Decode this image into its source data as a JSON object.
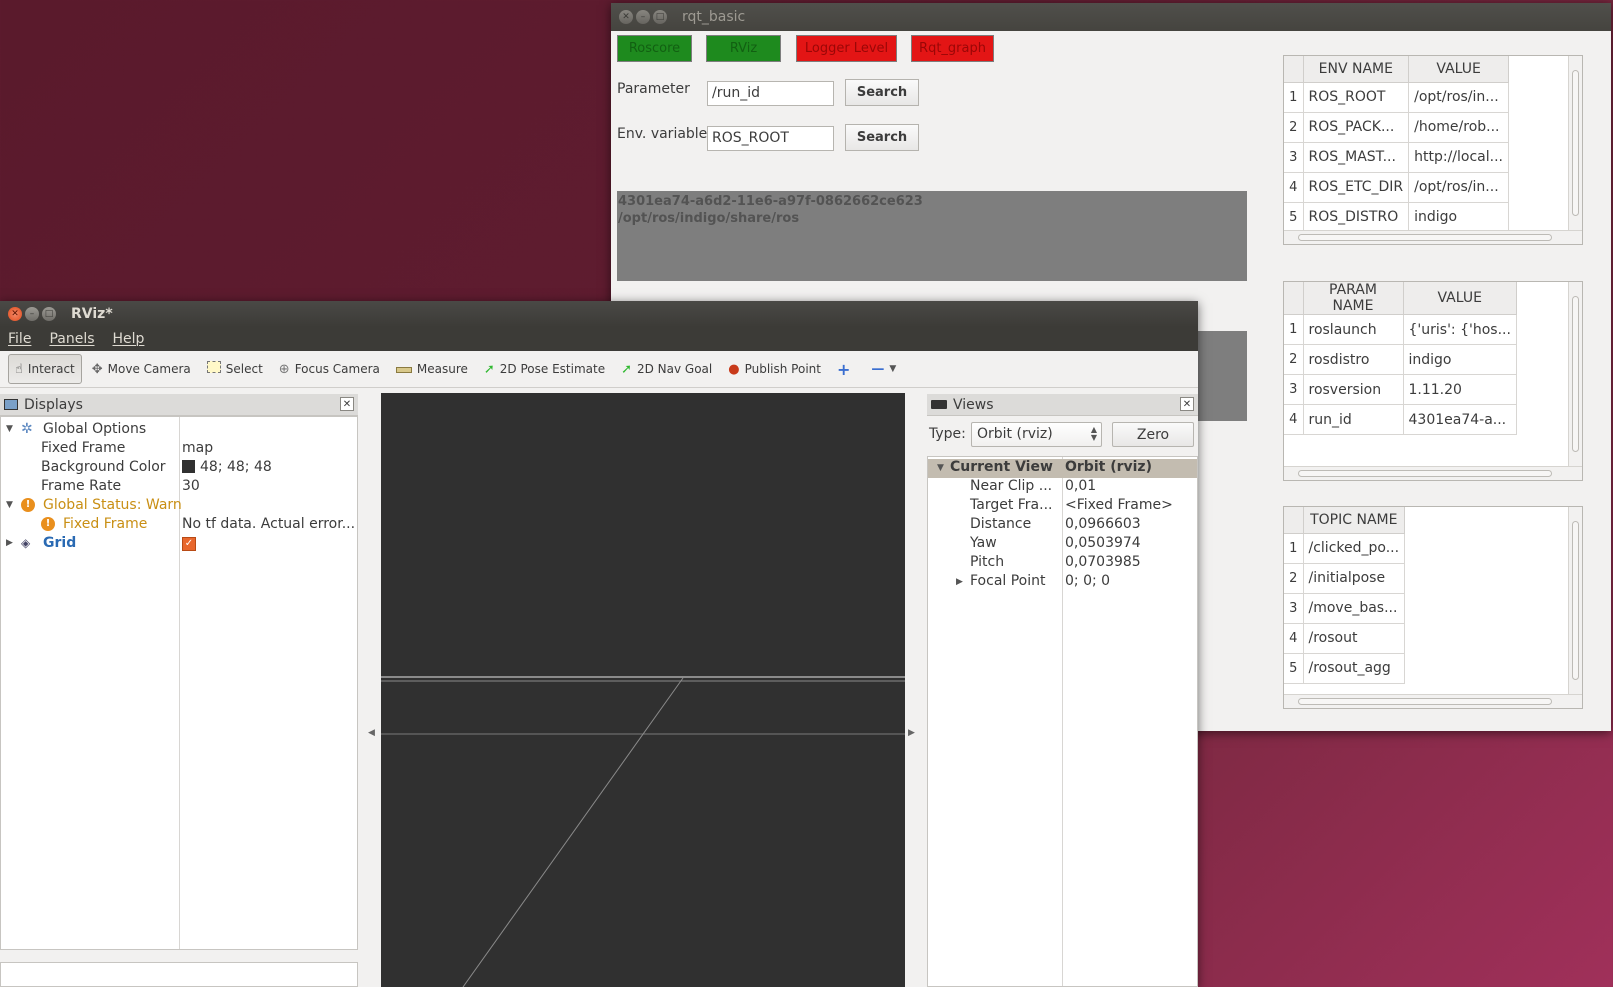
{
  "rqt": {
    "title": "rqt_basic",
    "buttons": [
      {
        "label": "Roscore",
        "color": "#1e8a1e"
      },
      {
        "label": "RViz",
        "color": "#1e8a1e"
      },
      {
        "label": "Logger Level",
        "color": "#e31515"
      },
      {
        "label": "Rqt_graph",
        "color": "#e31515"
      }
    ],
    "param_label": "Parameter",
    "param_value": "/run_id",
    "env_label": "Env. variable",
    "env_value": "ROS_ROOT",
    "search_label": "Search",
    "output_lines": [
      "4301ea74-a6d2-11e6-a97f-0862662ce623",
      "/opt/ros/indigo/share/ros"
    ],
    "env_table": {
      "headers": [
        "ENV NAME",
        "VALUE"
      ],
      "rows": [
        {
          "i": "1",
          "name": "ROS_ROOT",
          "value": "/opt/ros/in..."
        },
        {
          "i": "2",
          "name": "ROS_PACK...",
          "value": "/home/rob..."
        },
        {
          "i": "3",
          "name": "ROS_MAST...",
          "value": "http://local..."
        },
        {
          "i": "4",
          "name": "ROS_ETC_DIR",
          "value": "/opt/ros/in..."
        },
        {
          "i": "5",
          "name": "ROS_DISTRO",
          "value": "indigo"
        }
      ]
    },
    "param_table": {
      "headers": [
        "PARAM NAME",
        "VALUE"
      ],
      "rows": [
        {
          "i": "1",
          "name": "roslaunch",
          "value": "{'uris': {'hos..."
        },
        {
          "i": "2",
          "name": "rosdistro",
          "value": "indigo"
        },
        {
          "i": "3",
          "name": "rosversion",
          "value": "1.11.20"
        },
        {
          "i": "4",
          "name": "run_id",
          "value": "4301ea74-a..."
        }
      ]
    },
    "topic_table": {
      "headers": [
        "TOPIC NAME"
      ],
      "rows": [
        {
          "i": "1",
          "name": "/clicked_po..."
        },
        {
          "i": "2",
          "name": "/initialpose"
        },
        {
          "i": "3",
          "name": "/move_bas..."
        },
        {
          "i": "4",
          "name": "/rosout"
        },
        {
          "i": "5",
          "name": "/rosout_agg"
        }
      ]
    }
  },
  "rviz": {
    "title": "RViz*",
    "menu": [
      "File",
      "Panels",
      "Help"
    ],
    "tools": [
      {
        "label": "Interact",
        "icon": "hand-icon",
        "active": true
      },
      {
        "label": "Move Camera",
        "icon": "move-camera-icon"
      },
      {
        "label": "Select",
        "icon": "select-icon"
      },
      {
        "label": "Focus Camera",
        "icon": "focus-camera-icon"
      },
      {
        "label": "Measure",
        "icon": "measure-icon"
      },
      {
        "label": "2D Pose Estimate",
        "icon": "pose-estimate-icon"
      },
      {
        "label": "2D Nav Goal",
        "icon": "nav-goal-icon"
      },
      {
        "label": "Publish Point",
        "icon": "publish-point-icon"
      }
    ],
    "displays": {
      "title": "Displays",
      "global_options": "Global Options",
      "fixed_frame_label": "Fixed Frame",
      "fixed_frame_value": "map",
      "bg_color_label": "Background Color",
      "bg_color_value": "48; 48; 48",
      "bg_color_swatch": "#303030",
      "frame_rate_label": "Frame Rate",
      "frame_rate_value": "30",
      "global_status": "Global Status: Warn",
      "fixed_frame_status": "Fixed Frame",
      "fixed_frame_status_value": "No tf data.  Actual error...",
      "grid": "Grid"
    },
    "views": {
      "title": "Views",
      "type_label": "Type:",
      "type_value": "Orbit (rviz)",
      "zero_label": "Zero",
      "current_view": "Current View",
      "current_view_value": "Orbit (rviz)",
      "props": [
        {
          "k": "Near Clip ...",
          "v": "0,01"
        },
        {
          "k": "Target Fra...",
          "v": "<Fixed Frame>"
        },
        {
          "k": "Distance",
          "v": "0,0966603"
        },
        {
          "k": "Yaw",
          "v": "0,0503974"
        },
        {
          "k": "Pitch",
          "v": "0,0703985"
        },
        {
          "k": "Focal Point",
          "v": "0; 0; 0"
        }
      ]
    }
  }
}
